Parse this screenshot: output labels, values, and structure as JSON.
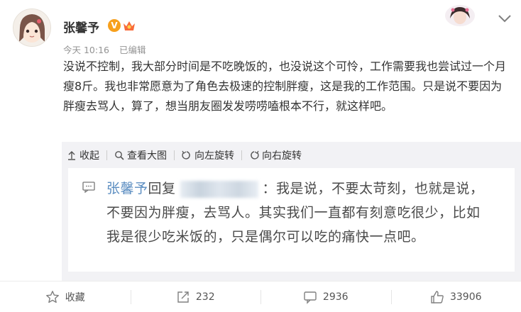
{
  "post": {
    "user_name": "张馨予",
    "verified_badge": "V",
    "time": "今天 10:16",
    "edited": "已编辑",
    "text": "没说不控制，我大部分时间是不吃晚饭的，也没说这个可怜，工作需要我也尝试过一个月瘦8斤。我也非常愿意为了角色去极速的控制胖瘦，这是我的工作范围。只是说不要因为胖瘦去骂人，算了，想当朋友圈发发唠唠嗑根本不行，就这样吧。"
  },
  "image_toolbar": {
    "collapse": "收起",
    "view_large": "查看大图",
    "rotate_left": "向左旋转",
    "rotate_right": "向右旋转"
  },
  "image_comment": {
    "name": "张馨予",
    "reply": "回复",
    "text": "：我是说，不要太苛刻，也就是说，不要因为胖瘦，去骂人。其实我们一直都有刻意吃很少，比如我是很少吃米饭的，只是偶尔可以吃的痛快一点吧。"
  },
  "actions": {
    "favorite": "收藏",
    "repost_count": "232",
    "comment_count": "2936",
    "like_count": "33906"
  },
  "colors": {
    "name_link": "#5b8dc1",
    "badge": "#f7a01c",
    "repost_bg": "#f2f2f5"
  }
}
